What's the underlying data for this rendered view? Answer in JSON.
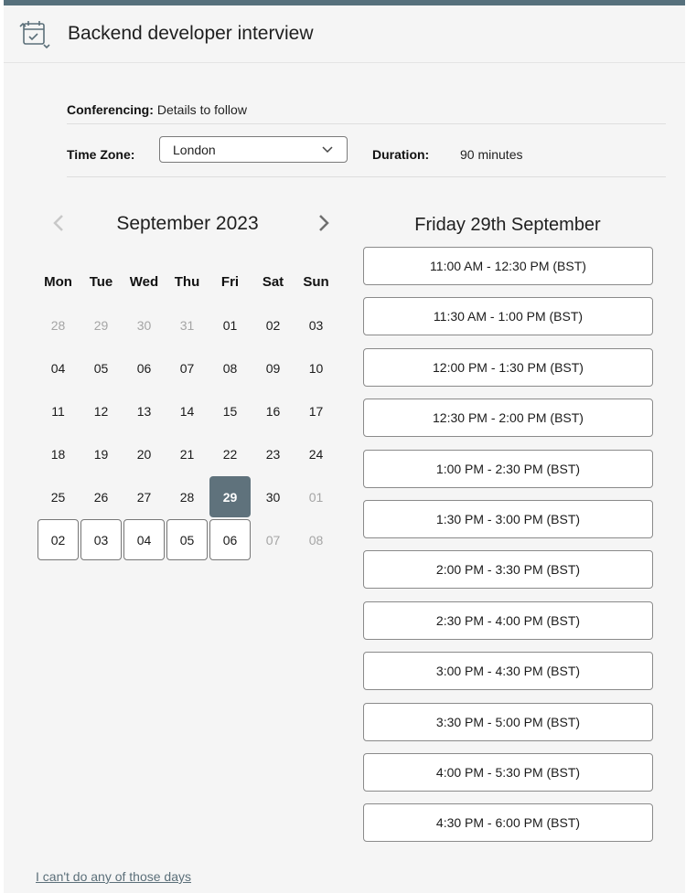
{
  "header": {
    "title": "Backend developer interview",
    "icon": "calendar-reschedule-icon"
  },
  "conferencing": {
    "label": "Conferencing:",
    "value": "Details to follow"
  },
  "timezone": {
    "label": "Time Zone:",
    "value": "London"
  },
  "duration": {
    "label": "Duration:",
    "value": "90 minutes"
  },
  "calendar": {
    "month_label": "September 2023",
    "weekdays": [
      "Mon",
      "Tue",
      "Wed",
      "Thu",
      "Fri",
      "Sat",
      "Sun"
    ],
    "days": [
      {
        "label": "28",
        "state": "muted"
      },
      {
        "label": "29",
        "state": "muted"
      },
      {
        "label": "30",
        "state": "muted"
      },
      {
        "label": "31",
        "state": "muted"
      },
      {
        "label": "01",
        "state": "normal"
      },
      {
        "label": "02",
        "state": "normal"
      },
      {
        "label": "03",
        "state": "normal"
      },
      {
        "label": "04",
        "state": "normal"
      },
      {
        "label": "05",
        "state": "normal"
      },
      {
        "label": "06",
        "state": "normal"
      },
      {
        "label": "07",
        "state": "normal"
      },
      {
        "label": "08",
        "state": "normal"
      },
      {
        "label": "09",
        "state": "normal"
      },
      {
        "label": "10",
        "state": "normal"
      },
      {
        "label": "11",
        "state": "normal"
      },
      {
        "label": "12",
        "state": "normal"
      },
      {
        "label": "13",
        "state": "normal"
      },
      {
        "label": "14",
        "state": "normal"
      },
      {
        "label": "15",
        "state": "normal"
      },
      {
        "label": "16",
        "state": "normal"
      },
      {
        "label": "17",
        "state": "normal"
      },
      {
        "label": "18",
        "state": "normal"
      },
      {
        "label": "19",
        "state": "normal"
      },
      {
        "label": "20",
        "state": "normal"
      },
      {
        "label": "21",
        "state": "normal"
      },
      {
        "label": "22",
        "state": "normal"
      },
      {
        "label": "23",
        "state": "normal"
      },
      {
        "label": "24",
        "state": "normal"
      },
      {
        "label": "25",
        "state": "normal"
      },
      {
        "label": "26",
        "state": "normal"
      },
      {
        "label": "27",
        "state": "normal"
      },
      {
        "label": "28",
        "state": "normal"
      },
      {
        "label": "29",
        "state": "selected"
      },
      {
        "label": "30",
        "state": "normal"
      },
      {
        "label": "01",
        "state": "muted"
      },
      {
        "label": "02",
        "state": "available"
      },
      {
        "label": "03",
        "state": "available"
      },
      {
        "label": "04",
        "state": "available"
      },
      {
        "label": "05",
        "state": "available"
      },
      {
        "label": "06",
        "state": "available"
      },
      {
        "label": "07",
        "state": "muted"
      },
      {
        "label": "08",
        "state": "muted"
      }
    ]
  },
  "selected_date_label": "Friday 29th September",
  "slots": [
    "11:00 AM - 12:30 PM (BST)",
    "11:30 AM - 1:00 PM (BST)",
    "12:00 PM - 1:30 PM (BST)",
    "12:30 PM - 2:00 PM (BST)",
    "1:00 PM - 2:30 PM (BST)",
    "1:30 PM - 3:00 PM (BST)",
    "2:00 PM - 3:30 PM (BST)",
    "2:30 PM - 4:00 PM (BST)",
    "3:00 PM - 4:30 PM (BST)",
    "3:30 PM - 5:00 PM (BST)",
    "4:00 PM - 5:30 PM (BST)",
    "4:30 PM - 6:00 PM (BST)"
  ],
  "cant_do_link": "I can't do any of those days",
  "colors": {
    "accent": "#5f727c",
    "top_bar": "#56707c",
    "muted_text": "#a5a5a5",
    "link": "#5b6f79"
  }
}
